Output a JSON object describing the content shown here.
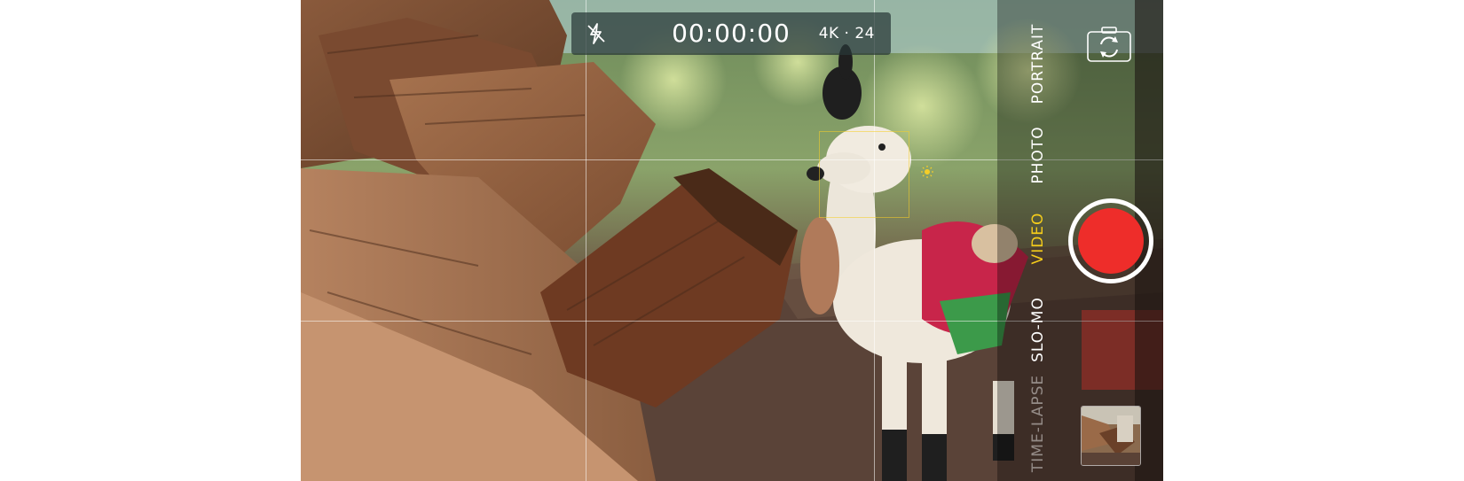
{
  "viewfinder": {
    "subject": "llama figurine",
    "grid": true
  },
  "topbar": {
    "flash_icon": "flash-off-icon",
    "timer": "00:00:00",
    "format": "4K · 24"
  },
  "modes": [
    {
      "label": "TIME-LAPSE",
      "state": "faded"
    },
    {
      "label": "SLO-MO",
      "state": "normal"
    },
    {
      "label": "VIDEO",
      "state": "active"
    },
    {
      "label": "PHOTO",
      "state": "normal"
    },
    {
      "label": "PORTRAIT",
      "state": "normal"
    }
  ],
  "controls": {
    "flip_icon": "camera-flip-icon",
    "shutter_icon": "record-button",
    "thumbnail_icon": "last-capture-thumbnail"
  },
  "colors": {
    "active_mode": "#f5cc1b",
    "record_red": "#ee2d2a",
    "focus_box": "#f5cd28"
  }
}
